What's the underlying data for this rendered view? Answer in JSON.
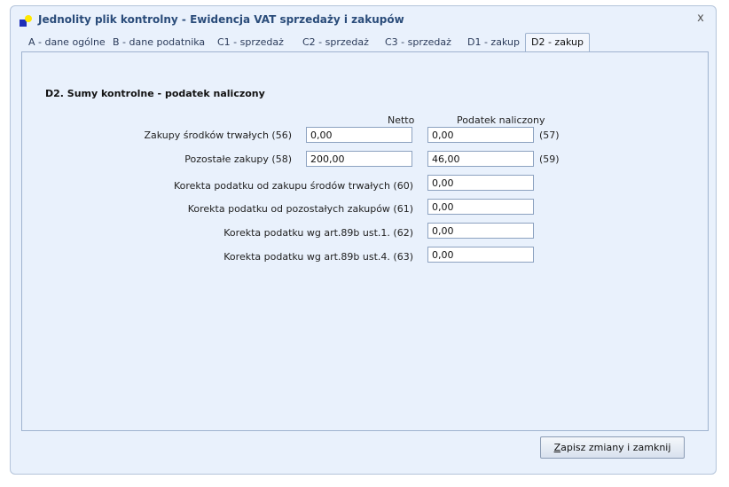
{
  "window": {
    "title": "Jednolity plik kontrolny - Ewidencja VAT sprzedaży i zakupów",
    "close": "x"
  },
  "tabs": [
    {
      "label": "A - dane ogólne"
    },
    {
      "label": "B  - dane podatnika"
    },
    {
      "label": "C1  - sprzedaż"
    },
    {
      "label": "C2  - sprzedaż"
    },
    {
      "label": "C3  - sprzedaż"
    },
    {
      "label": "D1  - zakup"
    },
    {
      "label": "D2  - zakup"
    }
  ],
  "active_tab": "D2  - zakup",
  "section": {
    "title": "D2. Sumy kontrolne - podatek naliczony",
    "col_netto": "Netto",
    "col_podatek": "Podatek naliczony",
    "rows": [
      {
        "label": "Zakupy środków trwałych (56)",
        "netto": "0,00",
        "podatek": "0,00",
        "code": "(57)"
      },
      {
        "label": "Pozostałe zakupy (58)",
        "netto": "200,00",
        "podatek": "46,00",
        "code": "(59)"
      },
      {
        "label": "Korekta podatku od zakupu środów trwałych (60)",
        "podatek": "0,00"
      },
      {
        "label": "Korekta podatku od pozostałych zakupów (61)",
        "podatek": "0,00"
      },
      {
        "label": "Korekta podatku wg art.89b ust.1. (62)",
        "podatek": "0,00"
      },
      {
        "label": "Korekta podatku wg art.89b ust.4. (63)",
        "podatek": "0,00"
      }
    ]
  },
  "buttons": {
    "save_close_first": "Z",
    "save_close_rest": "apisz zmiany i zamknij"
  }
}
